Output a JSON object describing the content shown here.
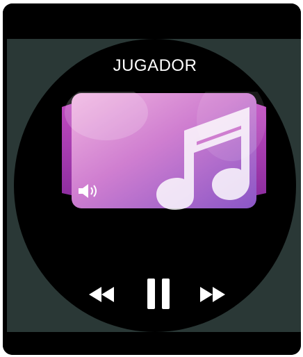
{
  "player": {
    "title": "JUGADOR"
  },
  "icons": {
    "album_art": "music-note-icon",
    "volume": "volume-icon",
    "rewind": "rewind-icon",
    "pause": "pause-icon",
    "fast_forward": "fast-forward-icon"
  },
  "colors": {
    "background": "#000000",
    "screen_edge": "#2a3836",
    "album_gradient_start": "#e8a3d8",
    "album_gradient_end": "#8a56c6",
    "album_side": "#b03ab6",
    "text": "#ffffff"
  }
}
